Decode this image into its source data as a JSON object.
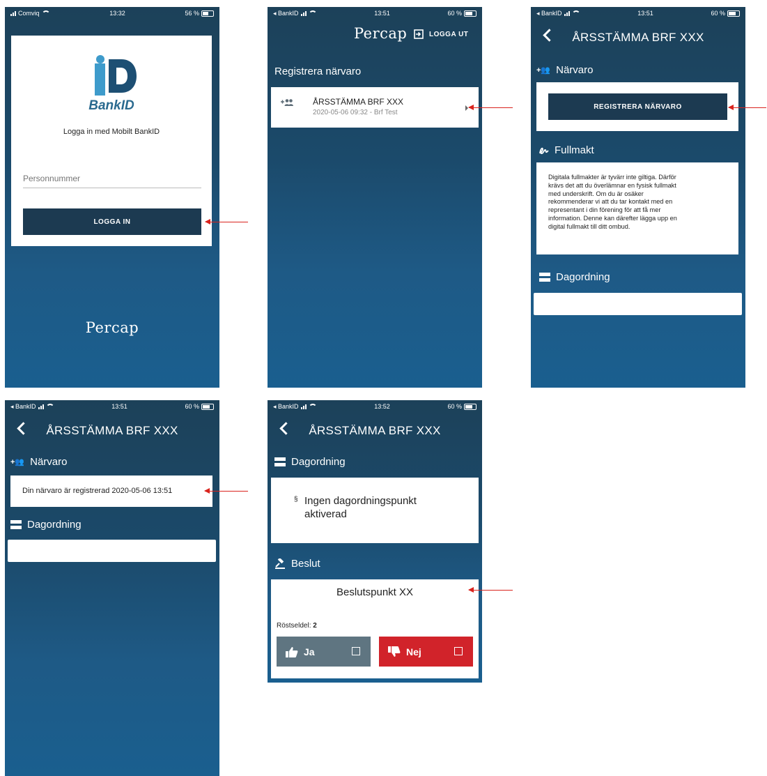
{
  "screen1": {
    "status": {
      "carrier": "Comviq",
      "time": "13:32",
      "battery": "56 %"
    },
    "login_prompt": "Logga in med Mobilt BankID",
    "personnummer_placeholder": "Personnummer",
    "login_button": "LOGGA IN",
    "bankid_text": "BankID",
    "footer_logo": "Percap"
  },
  "screen2": {
    "status": {
      "carrier": "◂ BankID",
      "time": "13:51",
      "battery": "60 %"
    },
    "logo": "Percap",
    "logout_label": "LOGGA UT",
    "section_title": "Registrera närvaro",
    "meeting": {
      "title": "ÅRSSTÄMMA BRF XXX",
      "subtitle": "2020-05-06 09:32 - Brf Test"
    }
  },
  "screen3": {
    "status": {
      "carrier": "◂ BankID",
      "time": "13:51",
      "battery": "60 %"
    },
    "title": "ÅRSSTÄMMA BRF XXX",
    "narvaro_title": "Närvaro",
    "register_button": "REGISTRERA NÄRVARO",
    "fullmakt_title": "Fullmakt",
    "fullmakt_lines": [
      "Digitala fullmakter är tyvärr inte giltiga. Därför",
      "krävs det att du överlämnar en fysisk fullmakt",
      "med underskrift. Om du är osäker",
      "rekommenderar vi att du tar kontakt med en",
      "representant i din förening för att få mer",
      "information. Denne kan därefter lägga upp en",
      "digital fullmakt till ditt ombud."
    ],
    "dagordning_title": "Dagordning"
  },
  "screen4": {
    "status": {
      "carrier": "◂ BankID",
      "time": "13:51",
      "battery": "60 %"
    },
    "title": "ÅRSSTÄMMA BRF XXX",
    "narvaro_title": "Närvaro",
    "registered_text": "Din närvaro är registrerad 2020-05-06 13:51",
    "dagordning_title": "Dagordning"
  },
  "screen5": {
    "status": {
      "carrier": "◂ BankID",
      "time": "13:52",
      "battery": "60 %"
    },
    "title": "ÅRSSTÄMMA BRF XXX",
    "dagordning_title": "Dagordning",
    "agenda_symbol": "§",
    "agenda_line1": "Ingen dagordningspunkt",
    "agenda_line2": "aktiverad",
    "beslut_title": "Beslut",
    "beslut_point": "Beslutspunkt XX",
    "rostsedel_label": "Röstseldel:",
    "rostsedel_value": "2",
    "yes_label": "Ja",
    "no_label": "Nej"
  },
  "colors": {
    "arrow": "#d9231d",
    "dark_button": "#1c3a51",
    "yes_button": "#5f7581",
    "no_button": "#d1232a",
    "bankid_blue": "#2a6a8f"
  }
}
